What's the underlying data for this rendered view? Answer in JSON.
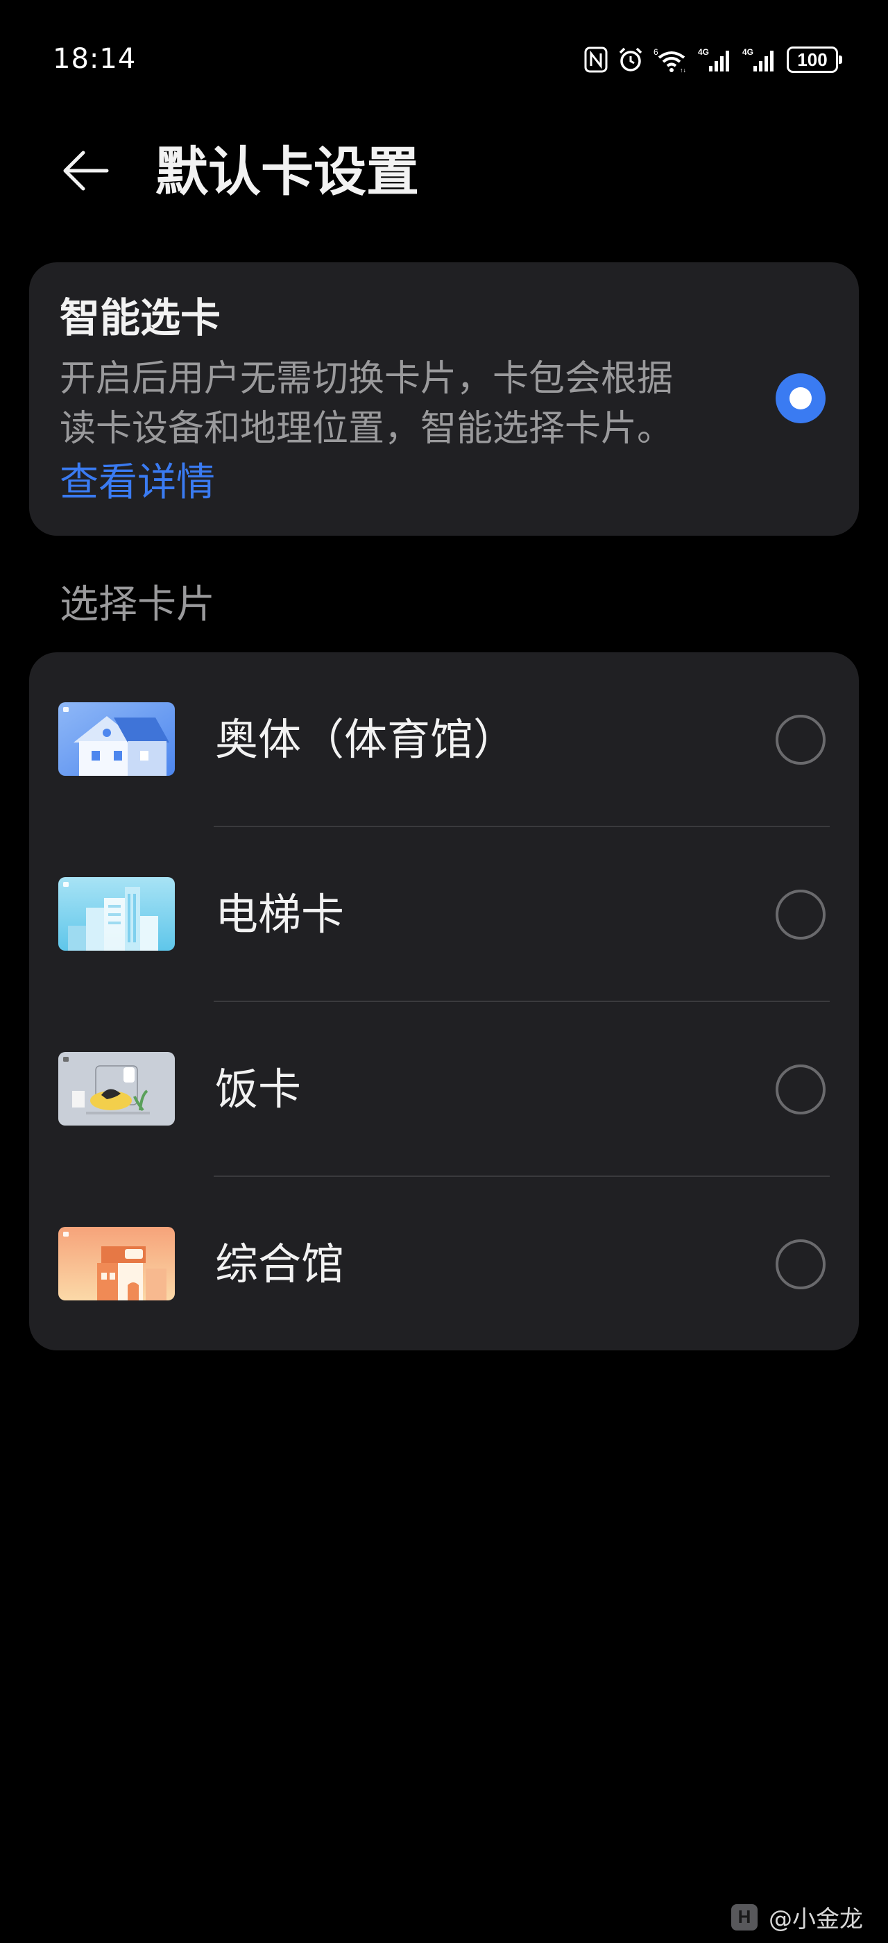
{
  "status_bar": {
    "time": "18:14",
    "battery": "100",
    "icons": [
      "nfc-icon",
      "alarm-icon",
      "wifi-icon",
      "signal-4g-icon",
      "signal-4g-icon",
      "battery-icon"
    ]
  },
  "header": {
    "title": "默认卡设置",
    "back_icon": "arrow-left-icon"
  },
  "smart_select": {
    "title": "智能选卡",
    "description_line1": "开启后用户无需切换卡片，卡包会根据",
    "description_line2": "读卡设备和地理位置，智能选择卡片。",
    "link": "查看详情",
    "selected": true
  },
  "card_section": {
    "title": "选择卡片",
    "cards": [
      {
        "name": "奥体（体育馆）",
        "thumbnail": "house-card-icon",
        "selected": false
      },
      {
        "name": "电梯卡",
        "thumbnail": "city-buildings-card-icon",
        "selected": false
      },
      {
        "name": "饭卡",
        "thumbnail": "desk-illustration-card-icon",
        "selected": false
      },
      {
        "name": "综合馆",
        "thumbnail": "orange-building-card-icon",
        "selected": false
      }
    ]
  },
  "watermark": {
    "logo": "H",
    "text": "@小金龙"
  },
  "colors": {
    "background": "#000000",
    "panel": "#202023",
    "accent": "#3a7bf2",
    "secondary_text": "#9a9a9c"
  }
}
